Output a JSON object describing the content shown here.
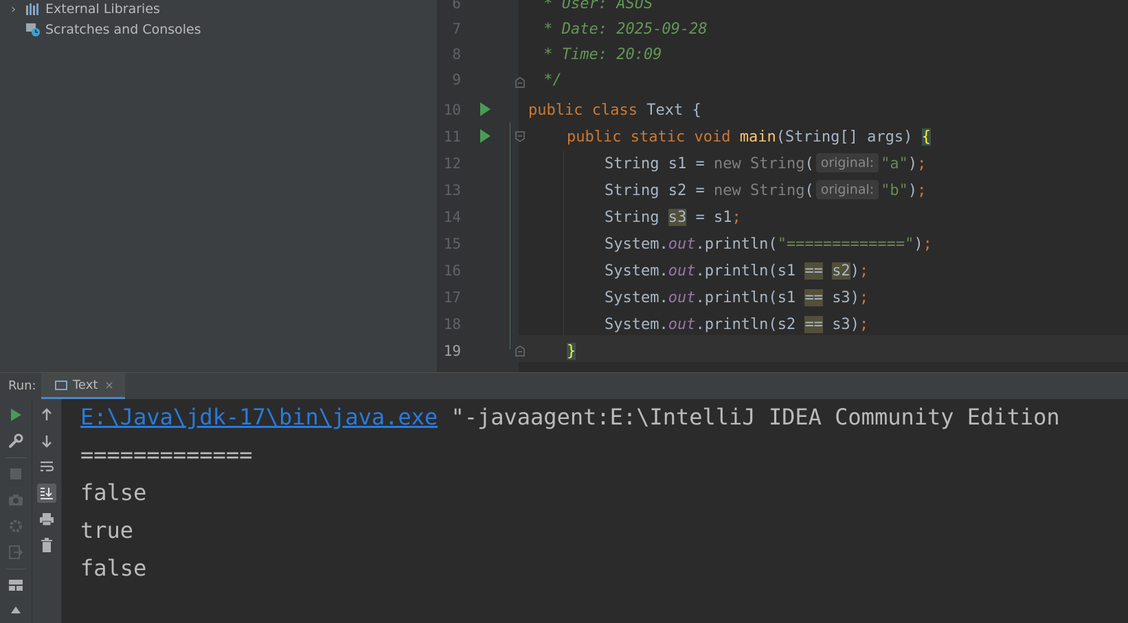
{
  "project_tree": {
    "items": [
      {
        "label": "External Libraries",
        "icon": "libraries-icon",
        "expandable": true
      },
      {
        "label": "Scratches and Consoles",
        "icon": "scratches-icon",
        "expandable": false
      }
    ]
  },
  "editor": {
    "line_numbers": [
      "6",
      "7",
      "8",
      "9",
      "10",
      "11",
      "12",
      "13",
      "14",
      "15",
      "16",
      "17",
      "18",
      "19"
    ],
    "current_line": "19",
    "comment_user": " * User: ASUS",
    "comment_date": " * Date: 2025-09-28",
    "comment_time": " * Time: 20:09",
    "comment_end": " */",
    "kw_public": "public",
    "kw_class": "class",
    "kw_static": "static",
    "kw_void": "void",
    "kw_new": "new",
    "class_name": "Text",
    "method_name": "main",
    "main_params": "(String[] args) ",
    "open_brace": "{",
    "close_brace": "}",
    "type_string": "String",
    "param_hint": "original:",
    "str_a": "\"a\"",
    "str_b": "\"b\"",
    "str_sep": "\"=============\"",
    "var_s1": "s1",
    "var_s2": "s2",
    "var_s3": "s3",
    "system": "System.",
    "field_out": "out",
    "println": ".println(",
    "op_eq": "==",
    "assign": " = ",
    "semicolon": ";",
    "close_paren": ")"
  },
  "run_panel": {
    "label": "Run:",
    "tab_label": "Text",
    "tab_close": "×"
  },
  "console": {
    "command_link": "E:\\Java\\jdk-17\\bin\\java.exe",
    "command_rest": " \"-javaagent:E:\\IntelliJ IDEA Community Edition",
    "output": [
      "=============",
      "false",
      "true",
      "false"
    ]
  },
  "colors": {
    "keyword": "#cc7832",
    "comment": "#629755",
    "string": "#6a8759",
    "field": "#9876aa",
    "method": "#ffc66d",
    "link": "#287bde",
    "run_green": "#499c54"
  }
}
